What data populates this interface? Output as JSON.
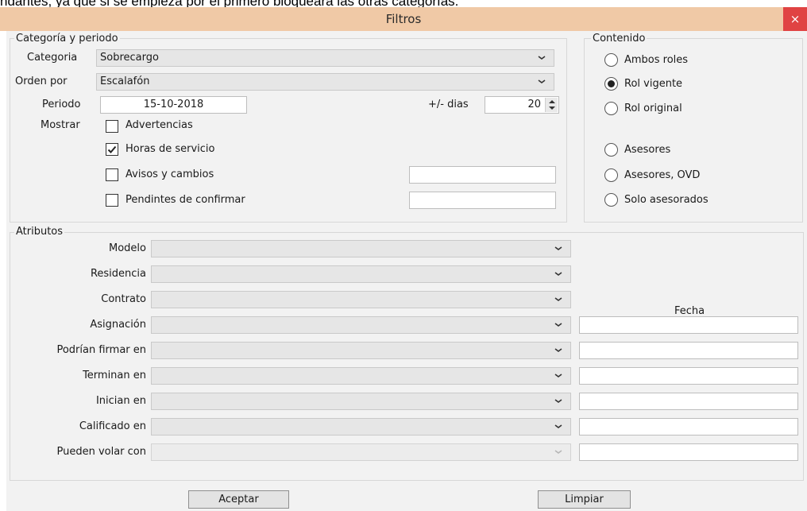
{
  "doc_text": "ndantes, ya que si se empieza por el primero bloqueará las otras categorías.",
  "window": {
    "title": "Filtros",
    "close_glyph": "×"
  },
  "categoria_periodo": {
    "legend": "Categoría y periodo",
    "categoria_label": "Categoria",
    "categoria_value": "Sobrecargo",
    "orden_label": "Orden por",
    "orden_value": "Escalafón",
    "periodo_label": "Periodo",
    "periodo_value": "15-10-2018",
    "dias_label": "+/- dias",
    "dias_value": "20",
    "mostrar_label": "Mostrar",
    "options": [
      {
        "label": "Advertencias",
        "checked": false
      },
      {
        "label": "Horas de servicio",
        "checked": true
      },
      {
        "label": "Avisos y cambios",
        "checked": false,
        "field_value": ""
      },
      {
        "label": "Pendintes de confirmar",
        "checked": false,
        "field_value": ""
      }
    ]
  },
  "contenido": {
    "legend": "Contenido",
    "radios": [
      {
        "label": "Ambos roles",
        "selected": false
      },
      {
        "label": "Rol vigente",
        "selected": true
      },
      {
        "label": "Rol original",
        "selected": false
      },
      {
        "label": "Asesores",
        "selected": false
      },
      {
        "label": "Asesores, OVD",
        "selected": false
      },
      {
        "label": "Solo asesorados",
        "selected": false
      }
    ]
  },
  "atributos": {
    "legend": "Atributos",
    "fecha_header": "Fecha",
    "rows": [
      {
        "label": "Modelo",
        "value": ""
      },
      {
        "label": "Residencia",
        "value": ""
      },
      {
        "label": "Contrato",
        "value": ""
      },
      {
        "label": "Asignación",
        "value": "",
        "fecha": ""
      },
      {
        "label": "Podrían firmar en",
        "value": "",
        "fecha": ""
      },
      {
        "label": "Terminan en",
        "value": "",
        "fecha": ""
      },
      {
        "label": "Inician en",
        "value": "",
        "fecha": ""
      },
      {
        "label": "Calificado en",
        "value": "",
        "fecha": ""
      },
      {
        "label": "Pueden volar con",
        "value": "",
        "fecha": "",
        "disabled": true
      }
    ]
  },
  "buttons": {
    "accept": "Aceptar",
    "clear": "Limpiar"
  },
  "icons": {
    "combo_arrow": "chevron-down-icon",
    "checkmark": "check-icon",
    "spinner": "spin-arrows-icon"
  }
}
